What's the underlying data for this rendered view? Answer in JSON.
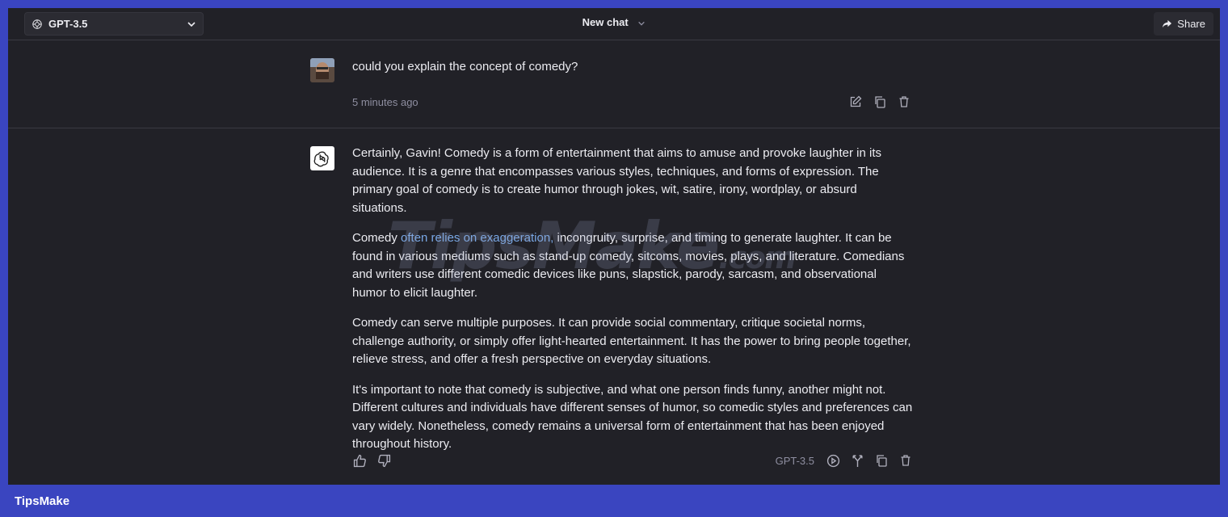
{
  "header": {
    "model_label": "GPT-3.5",
    "title": "New chat",
    "share_label": "Share"
  },
  "user_message": {
    "text": "could you explain the concept of comedy?",
    "timestamp": "5 minutes ago"
  },
  "assistant_message": {
    "paragraphs": [
      {
        "before": "Certainly, Gavin! Comedy is a form of entertainment that aims to amuse and provoke laughter in its audience. It is a genre that encompasses various styles, techniques, and forms of expression. The primary goal of comedy is to create humor through jokes, wit, satire, irony, wordplay, or absurd situations."
      },
      {
        "before": "Comedy ",
        "highlight": "often relies on exaggeration,",
        "after": " incongruity, surprise, and timing to generate laughter. It can be found in various mediums such as stand-up comedy, sitcoms, movies, plays, and literature. Comedians and writers use different comedic devices like puns, slapstick, parody, sarcasm, and observational humor to elicit laughter."
      },
      {
        "before": "Comedy can serve multiple purposes. It can provide social commentary, critique societal norms, challenge authority, or simply offer light-hearted entertainment. It has the power to bring people together, relieve stress, and offer a fresh perspective on everyday situations."
      },
      {
        "before": "It's important to note that comedy is subjective, and what one person finds funny, another might not. Different cultures and individuals have different senses of humor, so comedic styles and preferences can vary widely. Nonetheless, comedy remains a universal form of entertainment that has been enjoyed throughout history."
      }
    ],
    "model_tag": "GPT-3.5"
  },
  "watermark": {
    "text": "TipsMake",
    "suffix": ".com"
  },
  "footer": {
    "brand": "TipsMake"
  },
  "icons": {
    "model": "openai-logo-icon",
    "dropdown": "chevron-down-icon",
    "share": "share-arrow-icon",
    "edit": "edit-icon",
    "copy": "copy-icon",
    "delete": "trash-icon",
    "like": "thumbs-up-icon",
    "dislike": "thumbs-down-icon",
    "play": "play-circle-icon",
    "branch": "branch-icon"
  },
  "colors": {
    "frame": "#3a45c0",
    "background": "#212127",
    "text": "#ececf1",
    "muted": "#8e8ea0",
    "highlight": "#79a8e6"
  }
}
